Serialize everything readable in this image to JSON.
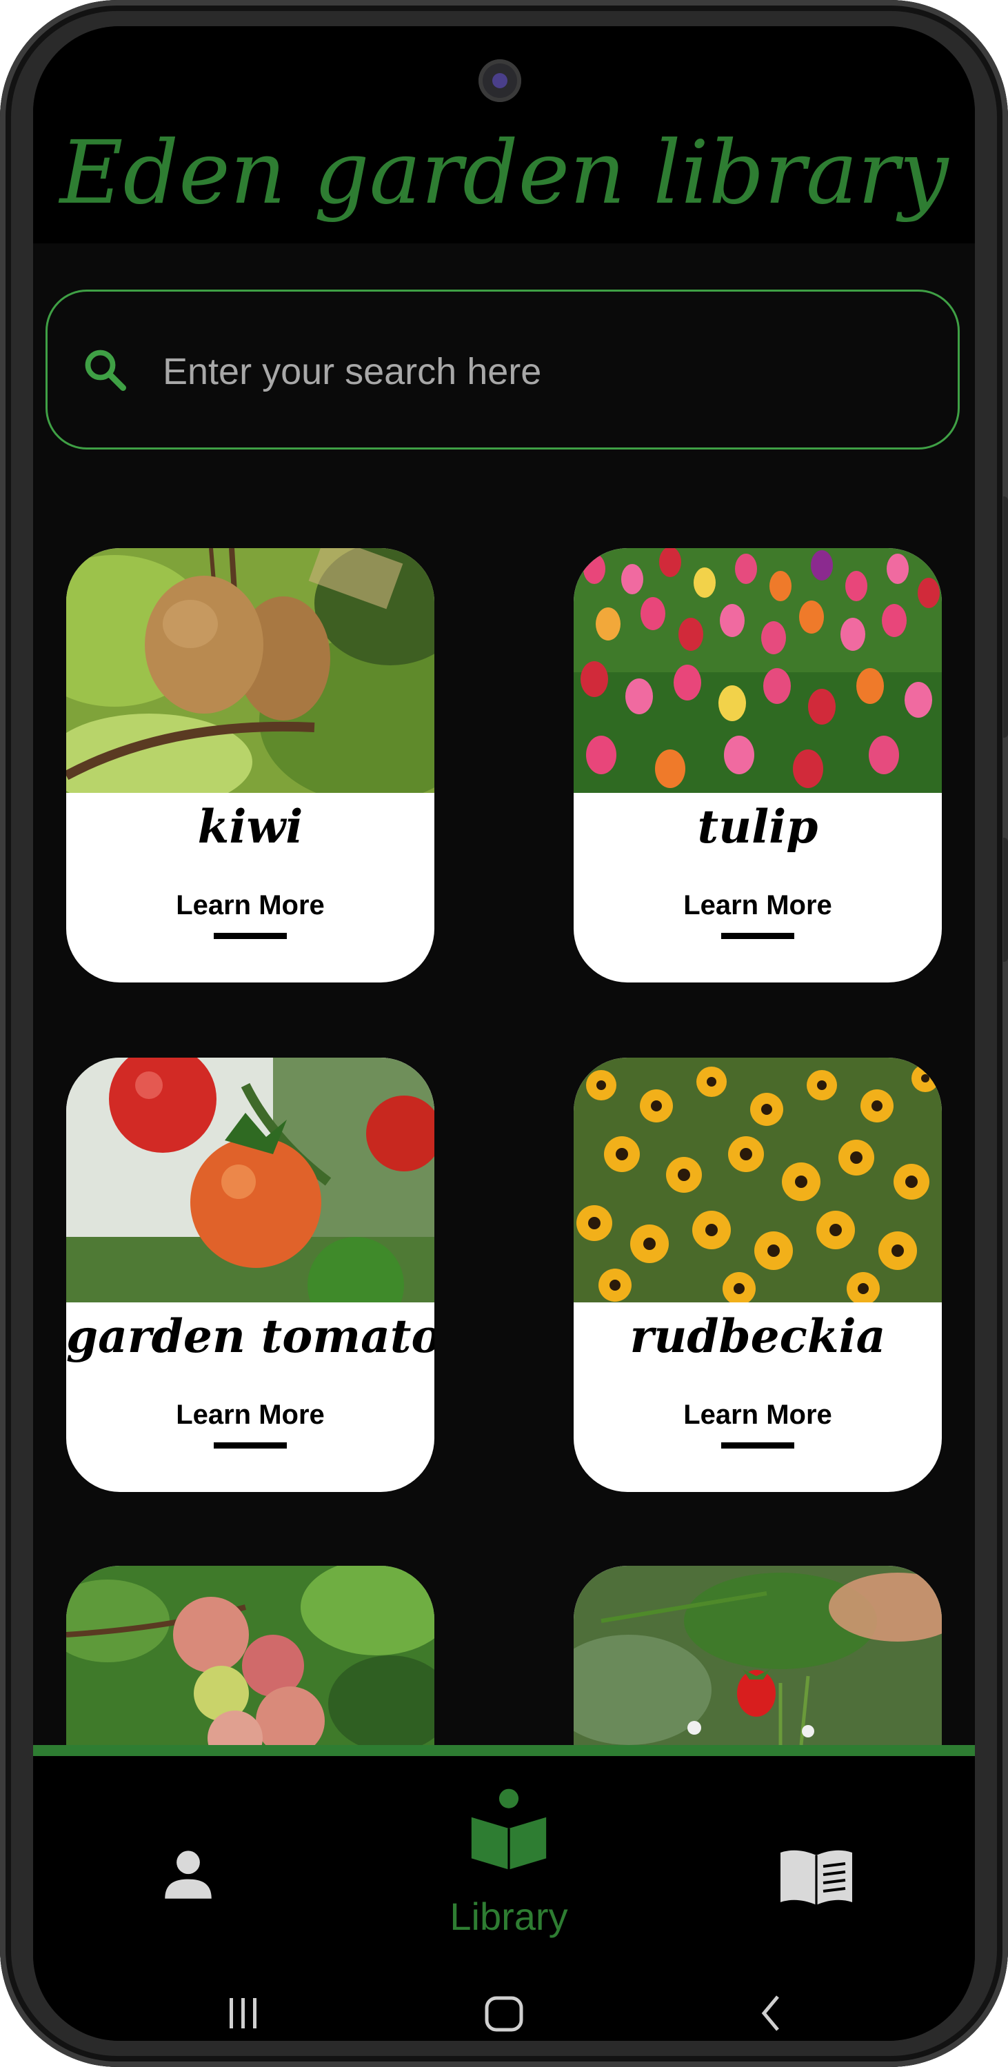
{
  "app": {
    "title": "Eden garden library"
  },
  "search": {
    "placeholder": "Enter your search here"
  },
  "plants": [
    {
      "name": "kiwi",
      "action": "Learn More"
    },
    {
      "name": "tulip",
      "action": "Learn More"
    },
    {
      "name": "garden tomato",
      "action": "Learn More"
    },
    {
      "name": "rudbeckia",
      "action": "Learn More"
    }
  ],
  "bottom_nav": {
    "items": [
      {
        "icon": "person-icon",
        "label": ""
      },
      {
        "icon": "library-reader-icon",
        "label": "Library"
      },
      {
        "icon": "book-icon",
        "label": ""
      }
    ],
    "active": "Library"
  },
  "colors": {
    "accent": "#2e7d32",
    "search_border": "#3fa045",
    "background": "#0a0a0a",
    "header": "#000000",
    "card": "#ffffff"
  }
}
